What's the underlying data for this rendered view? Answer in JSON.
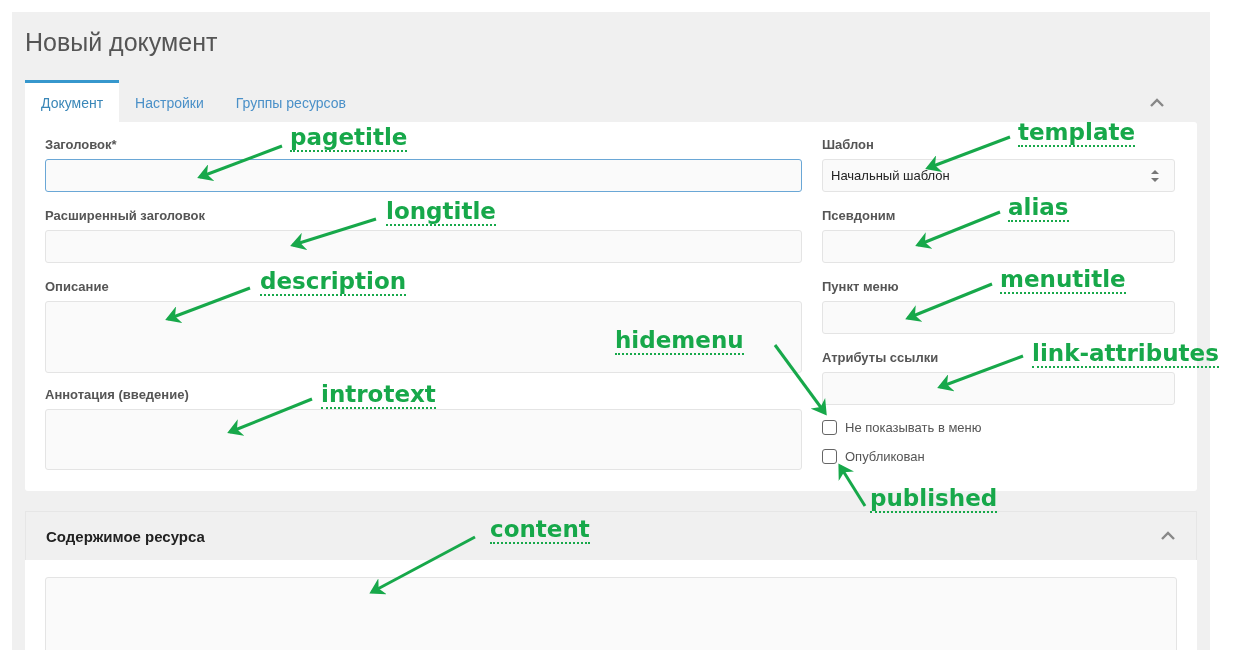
{
  "page_title": "Новый документ",
  "tabs": [
    {
      "label": "Документ",
      "selected": true
    },
    {
      "label": "Настройки",
      "selected": false
    },
    {
      "label": "Группы ресурсов",
      "selected": false
    }
  ],
  "left_fields": [
    {
      "label": "Заголовок*",
      "kind": "text",
      "focused": true
    },
    {
      "label": "Расширенный заголовок",
      "kind": "text",
      "focused": false
    },
    {
      "label": "Описание",
      "kind": "textarea",
      "focused": false
    },
    {
      "label": "Аннотация (введение)",
      "kind": "textarea",
      "focused": false
    }
  ],
  "right_fields": [
    {
      "label": "Шаблон",
      "kind": "select",
      "value": "Начальный шаблон"
    },
    {
      "label": "Псевдоним",
      "kind": "text"
    },
    {
      "label": "Пункт меню",
      "kind": "text"
    },
    {
      "label": "Атрибуты ссылки",
      "kind": "text"
    }
  ],
  "checkboxes": [
    {
      "label": "Не показывать в меню",
      "checked": false
    },
    {
      "label": "Опубликован",
      "checked": false
    }
  ],
  "content_section": {
    "title": "Содержимое ресурса"
  },
  "annotations": [
    {
      "label": "pagetitle"
    },
    {
      "label": "longtitle"
    },
    {
      "label": "description"
    },
    {
      "label": "introtext"
    },
    {
      "label": "template"
    },
    {
      "label": "alias"
    },
    {
      "label": "menutitle"
    },
    {
      "label": "link-attributes"
    },
    {
      "label": "hidemenu"
    },
    {
      "label": "published"
    },
    {
      "label": "content"
    }
  ]
}
